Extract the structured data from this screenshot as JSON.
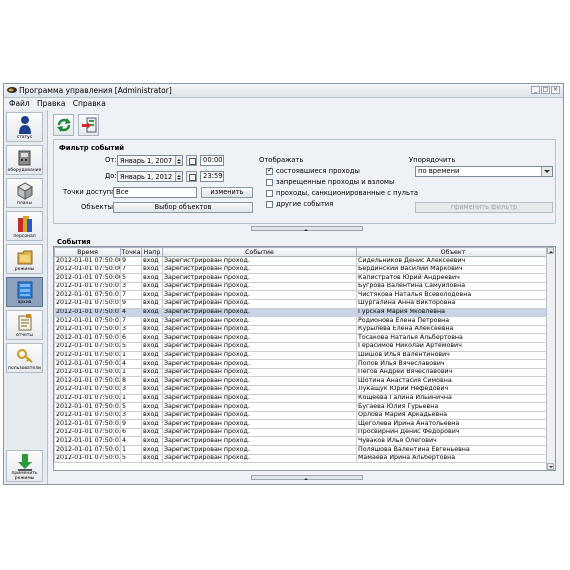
{
  "window": {
    "title": "Программа управления [Administrator]"
  },
  "menu": [
    "Файл",
    "Правка",
    "Справка"
  ],
  "sidebar": {
    "items": [
      {
        "label": "статус",
        "icon": "person-status-icon"
      },
      {
        "label": "оборудование",
        "icon": "equipment-icon"
      },
      {
        "label": "планы",
        "icon": "plans-icon"
      },
      {
        "label": "персонал",
        "icon": "personnel-icon"
      },
      {
        "label": "режимы",
        "icon": "modes-icon"
      },
      {
        "label": "архив",
        "icon": "archive-icon"
      },
      {
        "label": "отчеты",
        "icon": "reports-icon"
      },
      {
        "label": "пользователи",
        "icon": "users-key-icon"
      }
    ],
    "active": "архив",
    "apply_modes": "применить режимы"
  },
  "filter": {
    "title": "Фильтр событий",
    "from_label": "От:",
    "from_date": "Январь 1, 2007",
    "from_time": "00:00",
    "to_label": "До:",
    "to_date": "Январь 1, 2012",
    "to_time": "23:59",
    "access_points_label": "Точки доступа:",
    "access_points_value": "Все",
    "change_button": "изменить",
    "objects_label": "Объекты:",
    "objects_button": "Выбор объектов",
    "display_title": "Отображать",
    "checkboxes": [
      {
        "label": "состоявшиеся проходы",
        "checked": true
      },
      {
        "label": "запрещенные проходы и взломы",
        "checked": false
      },
      {
        "label": "проходы, санкционированные с пульта",
        "checked": false
      },
      {
        "label": "другие события",
        "checked": false
      }
    ],
    "order_title": "Упорядочить",
    "order_value": "по времени",
    "apply_button": "применить фильтр"
  },
  "events": {
    "title": "События",
    "columns": [
      "Время",
      "Точка",
      "Напр",
      "Событие",
      "Объект"
    ],
    "rows": [
      [
        "2012-01-01 07:50:00",
        "9",
        "вход",
        "Зарегистрирован проход.",
        "Сидельников Денис Алексеевич"
      ],
      [
        "2012-01-01 07:50:00",
        "7",
        "вход",
        "Зарегистрирован проход.",
        "Бердинский Василий Маркович"
      ],
      [
        "2012-01-01 07:50:00",
        "5",
        "вход",
        "Зарегистрирован проход.",
        "Капистратов Юрий Андреевич"
      ],
      [
        "2012-01-01 07:50:01",
        "3",
        "вход",
        "Зарегистрирован проход.",
        "Бугрова Валентина Самуиловна"
      ],
      [
        "2012-01-01 07:50:01",
        "7",
        "вход",
        "Зарегистрирован проход.",
        "Чистякова Наталья Всеволодовна"
      ],
      [
        "2012-01-01 07:50:01",
        "9",
        "вход",
        "Зарегистрирован проход.",
        "Шургалина Анна Викторовна"
      ],
      [
        "2012-01-01 07:50:01",
        "4",
        "вход",
        "Зарегистрирован проход.",
        "Гурская Мария Яковлевна"
      ],
      [
        "2012-01-01 07:50:01",
        "7",
        "вход",
        "Зарегистрирован проход.",
        "Родионова Елена Петровна"
      ],
      [
        "2012-01-01 07:50:01",
        "3",
        "вход",
        "Зарегистрирован проход.",
        "Курылева Елена Алексеевна"
      ],
      [
        "2012-01-01 07:50:01",
        "6",
        "вход",
        "Зарегистрирован проход.",
        "Тосакова Наталья Альбертовна"
      ],
      [
        "2012-01-01 07:50:02",
        "5",
        "вход",
        "Зарегистрирован проход.",
        "Герасимов Николай Артемович"
      ],
      [
        "2012-01-01 07:50:02",
        "1",
        "вход",
        "Зарегистрирован проход.",
        "Шишов Илья Валентинович"
      ],
      [
        "2012-01-01 07:50:02",
        "4",
        "вход",
        "Зарегистрирован проход.",
        "Попов Илья Вячеславович"
      ],
      [
        "2012-01-01 07:50:02",
        "1",
        "вход",
        "Зарегистрирован проход.",
        "Пегов Андрей Вячеславович"
      ],
      [
        "2012-01-01 07:50:02",
        "8",
        "вход",
        "Зарегистрирован проход.",
        "Шотина Анастасия Симовна"
      ],
      [
        "2012-01-01 07:50:02",
        "3",
        "вход",
        "Зарегистрирован проход.",
        "Лукащук Юрий Нефедович"
      ],
      [
        "2012-01-01 07:50:02",
        "1",
        "вход",
        "Зарегистрирован проход.",
        "Кощеева Галина Ильинична"
      ],
      [
        "2012-01-01 07:50:03",
        "5",
        "вход",
        "Зарегистрирован проход.",
        "Бугаева Юлия Гурьевна"
      ],
      [
        "2012-01-01 07:50:02",
        "3",
        "вход",
        "Зарегистрирован проход.",
        "Орлова Мария Аркадьевна"
      ],
      [
        "2012-01-01 07:50:03",
        "9",
        "вход",
        "Зарегистрирован проход.",
        "Щеголева Ирина Анатольевна"
      ],
      [
        "2012-01-01 07:50:03",
        "6",
        "вход",
        "Зарегистрирован проход.",
        "Просвирнин Денис Федорович"
      ],
      [
        "2012-01-01 07:50:03",
        "4",
        "вход",
        "Зарегистрирован проход.",
        "Чуваков Илья Олегович"
      ],
      [
        "2012-01-01 07:50:03",
        "1",
        "вход",
        "Зарегистрирован проход.",
        "Поляшова Валентина Евгеньевна"
      ],
      [
        "2012-01-01 07:50:03",
        "5",
        "вход",
        "Зарегистрирован проход.",
        "Мамаева Ирина Альбертовна"
      ]
    ],
    "selected_row": 6
  },
  "colors": {
    "selection": "#c7d4e6",
    "active_sidebar": "#8ea2bf"
  }
}
